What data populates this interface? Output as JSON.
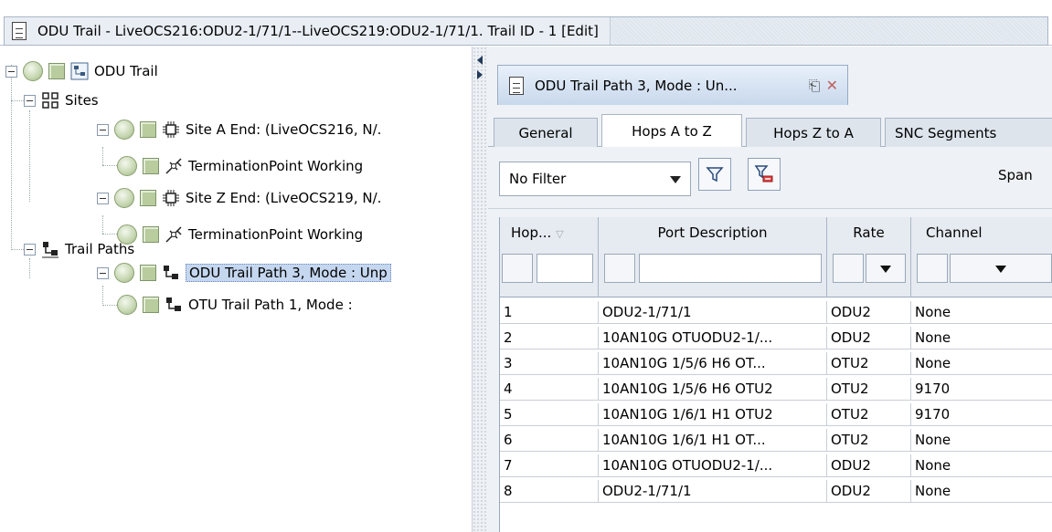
{
  "window": {
    "title": "ODU Trail - LiveOCS216:ODU2-1/71/1--LiveOCS219:ODU2-1/71/1. Trail ID - 1 [Edit]",
    "icon": "document-icon"
  },
  "tree": {
    "items": [
      {
        "label": "ODU Trail"
      },
      {
        "label": "Sites"
      },
      {
        "label": "Site A End: (LiveOCS216, N/."
      },
      {
        "label": "TerminationPoint Working"
      },
      {
        "label": "Site Z End: (LiveOCS219, N/."
      },
      {
        "label": "TerminationPoint Working"
      },
      {
        "label": "Trail Paths"
      },
      {
        "label": "ODU Trail Path 3, Mode : Unp"
      },
      {
        "label": "OTU Trail Path 1, Mode :"
      }
    ]
  },
  "panel": {
    "tab_title": "ODU Trail Path 3, Mode : Un...",
    "subtabs": [
      "General",
      "Hops A to Z",
      "Hops Z to A",
      "SNC Segments"
    ],
    "active_subtab": "Hops A to Z",
    "filter": {
      "selected": "No Filter"
    },
    "span_label": "Span"
  },
  "grid": {
    "columns": [
      "Hop...",
      "Port Description",
      "Rate",
      "Channel"
    ],
    "rows": [
      [
        "1",
        "ODU2-1/71/1",
        "ODU2",
        "None"
      ],
      [
        "2",
        "10AN10G OTUODU2-1/...",
        "ODU2",
        "None"
      ],
      [
        "3",
        "10AN10G 1/5/6 H6 OT...",
        "OTU2",
        "None"
      ],
      [
        "4",
        "10AN10G 1/5/6 H6 OTU2",
        "OTU2",
        "9170"
      ],
      [
        "5",
        "10AN10G 1/6/1 H1 OTU2",
        "OTU2",
        "9170"
      ],
      [
        "6",
        "10AN10G 1/6/1 H1 OT...",
        "OTU2",
        "None"
      ],
      [
        "7",
        "10AN10G OTUODU2-1/...",
        "ODU2",
        "None"
      ],
      [
        "8",
        "ODU2-1/71/1",
        "ODU2",
        "None"
      ]
    ]
  },
  "colors": {
    "selection": "#c5d7ef",
    "panel_bg": "#eef1f5",
    "status_green": "#c5d6b0"
  }
}
